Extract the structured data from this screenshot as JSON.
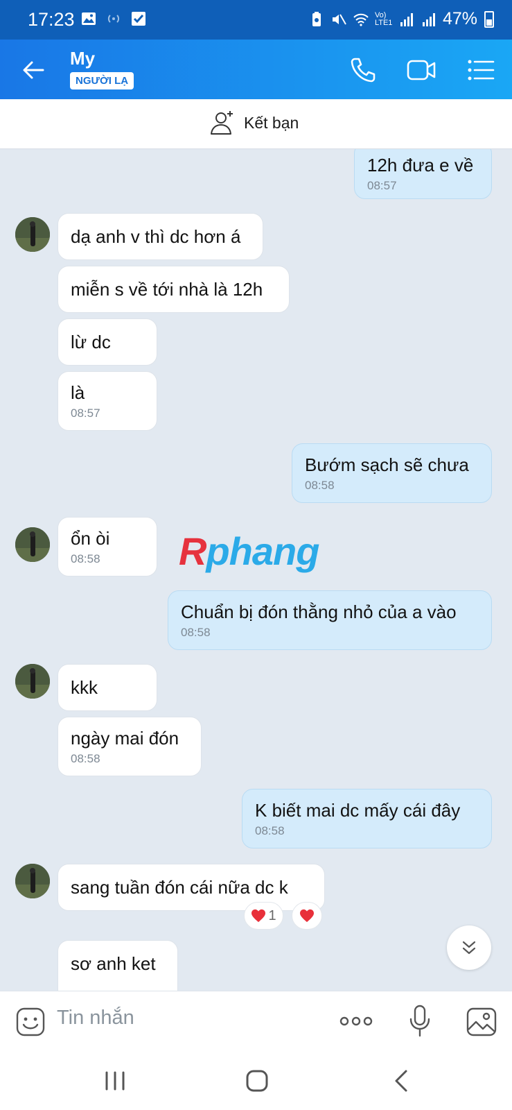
{
  "status_bar": {
    "time": "17:23",
    "network": "Vo) LTE1",
    "battery": "47%"
  },
  "header": {
    "name": "My",
    "badge": "NGƯỜI LẠ"
  },
  "add_friend": {
    "label": "Kết bạn"
  },
  "watermark": {
    "part1": "R",
    "part2": "phang"
  },
  "messages": [
    {
      "text": "12h đưa e về",
      "time": "08:57"
    },
    {
      "text": "dạ anh v thì dc hơn á"
    },
    {
      "text": "miễn s về tới nhà là 12h"
    },
    {
      "text": "lừ dc"
    },
    {
      "text": "là",
      "time": "08:57"
    },
    {
      "text": "Bướm sạch sẽ chưa",
      "time": "08:58"
    },
    {
      "text": "ổn òi",
      "time": "08:58"
    },
    {
      "text": "Chuẩn bị đón thằng nhỏ của a vào",
      "time": "08:58"
    },
    {
      "text": "kkk"
    },
    {
      "text": "ngày mai đón",
      "time": "08:58"
    },
    {
      "text": "K biết mai dc mấy cái đây",
      "time": "08:58"
    },
    {
      "text": "sang tuần đón cái nữa dc k"
    },
    {
      "text": "sơ anh ket"
    }
  ],
  "reaction": {
    "count": "1",
    "icon": "heart-icon",
    "color": "#e8303a"
  },
  "composer": {
    "placeholder": "Tin nhắn"
  },
  "colors": {
    "header_start": "#1977e6",
    "header_end": "#1aa7f5",
    "outgoing_bubble": "#d4ebfb",
    "chat_bg": "#e2e9f1"
  }
}
